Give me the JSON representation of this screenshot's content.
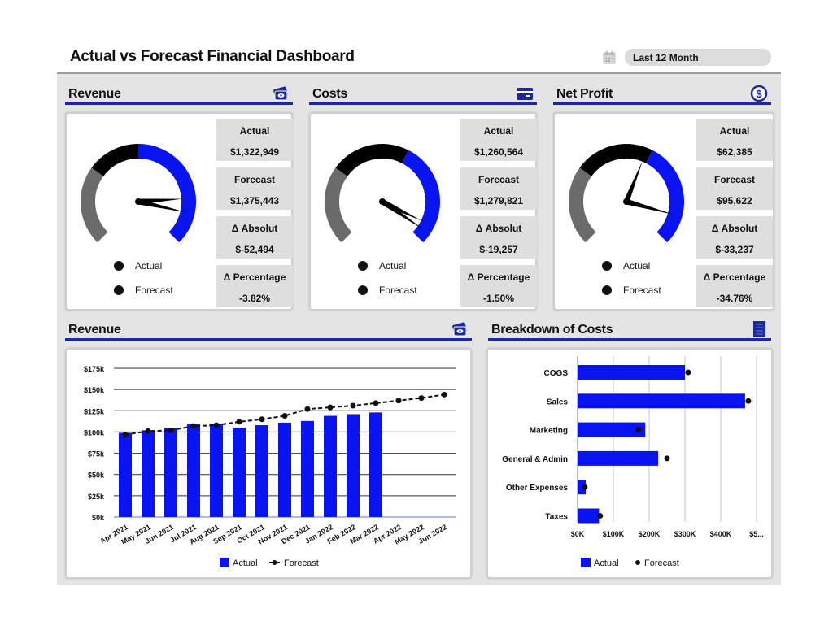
{
  "header": {
    "title": "Actual vs Forecast Financial Dashboard",
    "date_range": "Last 12 Month",
    "calendar_icon": "calendar-icon"
  },
  "gauges": [
    {
      "title": "Revenue",
      "icon": "money-icon",
      "actual_label": "Actual",
      "actual": "$1,322,949",
      "forecast_label": "Forecast",
      "forecast": "$1,375,443",
      "abs_label": "Δ Absolut",
      "abs": "$-52,494",
      "pct_label": "Δ Percentage",
      "pct": "-3.82%",
      "legend_actual": "Actual",
      "legend_forecast": "Forecast",
      "actual_ratio": 0.82,
      "forecast_ratio": 0.88
    },
    {
      "title": "Costs",
      "icon": "credit-card-icon",
      "actual_label": "Actual",
      "actual": "$1,260,564",
      "forecast_label": "Forecast",
      "forecast": "$1,279,821",
      "abs_label": "Δ Absolut",
      "abs": "$-19,257",
      "pct_label": "Δ Percentage",
      "pct": "-1.50%",
      "legend_actual": "Actual",
      "legend_forecast": "Forecast",
      "actual_ratio": 0.93,
      "forecast_ratio": 0.96
    },
    {
      "title": "Net Profit",
      "icon": "dollar-circle-icon",
      "actual_label": "Actual",
      "actual": "$62,385",
      "forecast_label": "Forecast",
      "forecast": "$95,622",
      "abs_label": "Δ Absolut",
      "abs": "$-33,237",
      "pct_label": "Δ Percentage",
      "pct": "-34.76%",
      "legend_actual": "Actual",
      "legend_forecast": "Forecast",
      "actual_ratio": 0.58,
      "forecast_ratio": 0.89
    }
  ],
  "revenue_chart_header": {
    "title": "Revenue",
    "icon": "money-icon"
  },
  "breakdown_header": {
    "title": "Breakdown of Costs",
    "icon": "list-icon"
  },
  "chart_data": [
    {
      "type": "bar",
      "title": "Revenue",
      "categories": [
        "Apr 2021",
        "May 2021",
        "Jun 2021",
        "Jul 2021",
        "Aug 2021",
        "Sep 2021",
        "Oct 2021",
        "Nov 2021",
        "Dec 2021",
        "Jan 2022",
        "Feb 2022",
        "Mar 2022",
        "Apr 2022",
        "May 2022",
        "Jun 2022"
      ],
      "series": [
        {
          "name": "Actual",
          "type": "bar",
          "color": "#0a14f0",
          "values": [
            99,
            102,
            105,
            109,
            110,
            105,
            108,
            111,
            113,
            119,
            121,
            123,
            null,
            null,
            null
          ]
        },
        {
          "name": "Forecast",
          "type": "line",
          "color": "#111111",
          "values": [
            97,
            101,
            102,
            107,
            108,
            112,
            115,
            119,
            127,
            129,
            131,
            134,
            137,
            140,
            144
          ]
        }
      ],
      "units": "$k",
      "yticks": [
        "$0k",
        "$25k",
        "$50k",
        "$75k",
        "$100k",
        "$125k",
        "$150k",
        "$175k"
      ],
      "ylim": [
        0,
        175
      ],
      "grid": true,
      "legend": "bottom"
    },
    {
      "type": "bar",
      "title": "Breakdown of Costs",
      "orientation": "horizontal",
      "categories": [
        "COGS",
        "Sales",
        "Marketing",
        "General & Admin",
        "Other Expenses",
        "Taxes"
      ],
      "series": [
        {
          "name": "Actual",
          "type": "bar",
          "color": "#0a14f0",
          "values": [
            300,
            468,
            189,
            225,
            23,
            60
          ]
        },
        {
          "name": "Forecast",
          "type": "dot",
          "color": "#111111",
          "values": [
            309,
            477,
            170,
            250,
            20,
            63
          ]
        }
      ],
      "units": "$K",
      "xticks": [
        "$0K",
        "$100K",
        "$200K",
        "$300K",
        "$400K",
        "$5..."
      ],
      "xlim": [
        0,
        500
      ],
      "grid": true,
      "legend": "bottom"
    }
  ]
}
